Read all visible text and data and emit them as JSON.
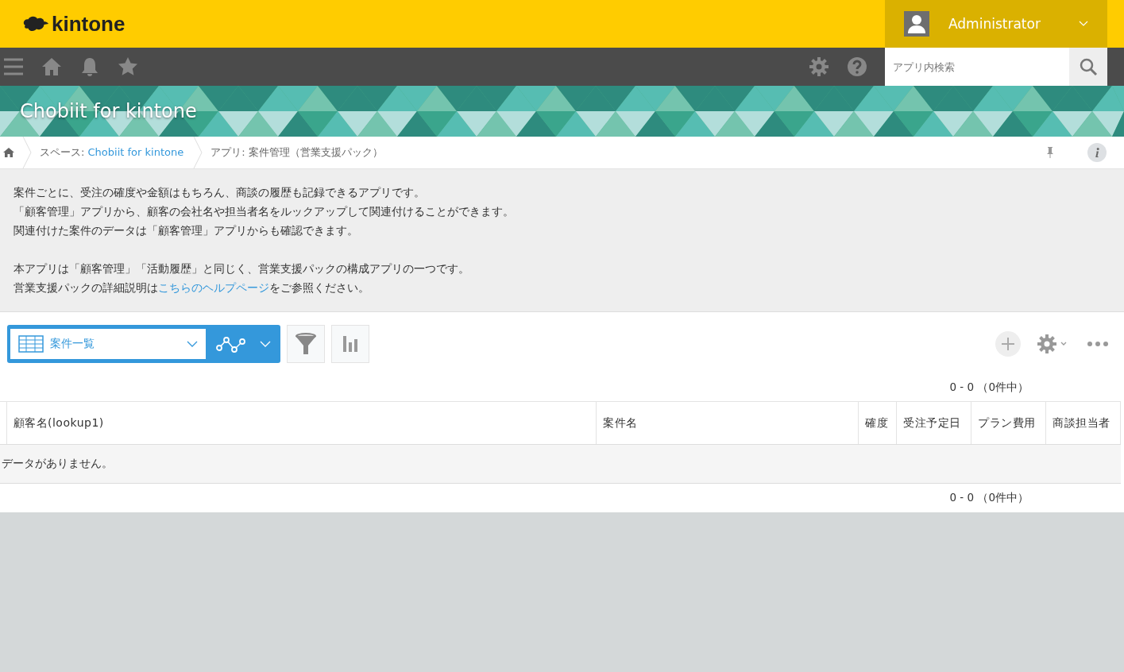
{
  "header": {
    "logo": "kintone",
    "user": {
      "name": "Administrator"
    }
  },
  "toolbar": {
    "search": {
      "placeholder": "アプリ内検索"
    }
  },
  "banner": {
    "title": "Chobiit for kintone"
  },
  "breadcrumb": [
    {
      "prefix": "スペース: ",
      "label": "Chobiit for kintone",
      "link": true
    },
    {
      "prefix": "アプリ: ",
      "label": "案件管理（営業支援パック）",
      "link": false
    }
  ],
  "description": [
    {
      "lines": [
        {
          "text": "案件ごとに、受注の確度や金額はもちろん、商談の履歴も記録できるアプリです。"
        },
        {
          "text": "「顧客管理」アプリから、顧客の会社名や担当者名をルックアップして関連付けることができます。"
        },
        {
          "text": "関連付けた案件のデータは「顧客管理」アプリからも確認できます。"
        }
      ]
    },
    {
      "lines": [
        {
          "text": "本アプリは「顧客管理」「活動履歴」と同じく、営業支援パックの構成アプリの一つです。"
        },
        {
          "text": "営業支援パックの詳細説明は",
          "link": "こちらのヘルプページ",
          "after": "をご参照ください。"
        }
      ]
    }
  ],
  "view": {
    "selected_view": "案件一覧"
  },
  "pagination_top": "0 - 0 （0件中）",
  "table": {
    "columns": [
      "顧客名(lookup1)",
      "案件名",
      "確度",
      "受注予定日",
      "プラン費用",
      "商談担当者"
    ],
    "empty_message": "データがありません。"
  },
  "pagination_bottom": "0 - 0 （0件中）"
}
